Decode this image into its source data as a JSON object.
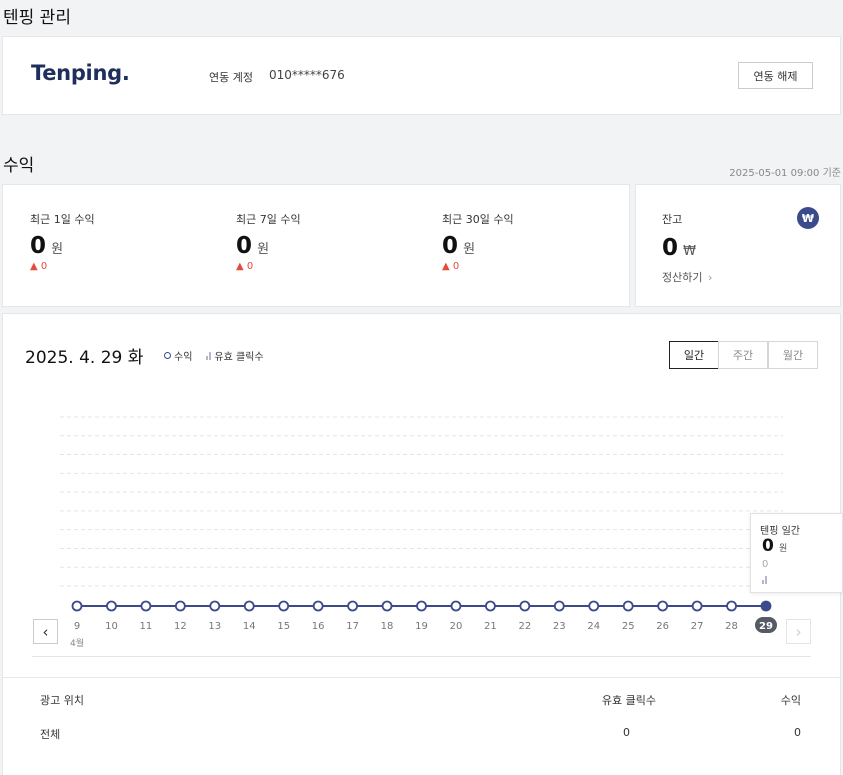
{
  "header": {
    "title": "텐핑 관리"
  },
  "account": {
    "logo": "Tenping.",
    "label": "연동 계정",
    "phone": "010*****676",
    "unlink_button": "연동 해제"
  },
  "earnings": {
    "title": "수익",
    "timestamp": "2025-05-01 09:00 기준",
    "stats": [
      {
        "label": "최근 1일 수익",
        "value": "0",
        "unit": "원",
        "change": "0"
      },
      {
        "label": "최근 7일 수익",
        "value": "0",
        "unit": "원",
        "change": "0"
      },
      {
        "label": "최근 30일 수익",
        "value": "0",
        "unit": "원",
        "change": "0"
      }
    ],
    "balance": {
      "label": "잔고",
      "value": "0",
      "unit": "₩",
      "settle_link": "정산하기",
      "icon": "won-icon"
    }
  },
  "chart_panel": {
    "date": "2025. 4. 29 화",
    "legend_revenue": "수익",
    "legend_clicks": "유효 클릭수",
    "period_tabs": [
      "일간",
      "주간",
      "월간"
    ],
    "active_tab": "일간",
    "prev_icon": "chevron-left-icon",
    "next_icon": "chevron-right-icon",
    "tooltip": {
      "title": "텐핑 일간",
      "value": "0",
      "unit": "원",
      "clicks": "0"
    },
    "colors": {
      "line": "#3b4a8a",
      "active": "#555a66"
    }
  },
  "chart_data": {
    "type": "line",
    "categories": [
      "9",
      "10",
      "11",
      "12",
      "13",
      "14",
      "15",
      "16",
      "17",
      "18",
      "19",
      "20",
      "21",
      "22",
      "23",
      "24",
      "25",
      "26",
      "27",
      "28",
      "29"
    ],
    "month_label": "4월",
    "series": [
      {
        "name": "수익",
        "values": [
          0,
          0,
          0,
          0,
          0,
          0,
          0,
          0,
          0,
          0,
          0,
          0,
          0,
          0,
          0,
          0,
          0,
          0,
          0,
          0,
          0
        ]
      },
      {
        "name": "유효 클릭수",
        "values": [
          0,
          0,
          0,
          0,
          0,
          0,
          0,
          0,
          0,
          0,
          0,
          0,
          0,
          0,
          0,
          0,
          0,
          0,
          0,
          0,
          0
        ]
      }
    ],
    "selected_index": 20,
    "grid": true
  },
  "table": {
    "headers": [
      "광고 위치",
      "유효 클릭수",
      "수익"
    ],
    "rows": [
      {
        "location": "전체",
        "clicks": "0",
        "revenue": "0"
      }
    ]
  }
}
